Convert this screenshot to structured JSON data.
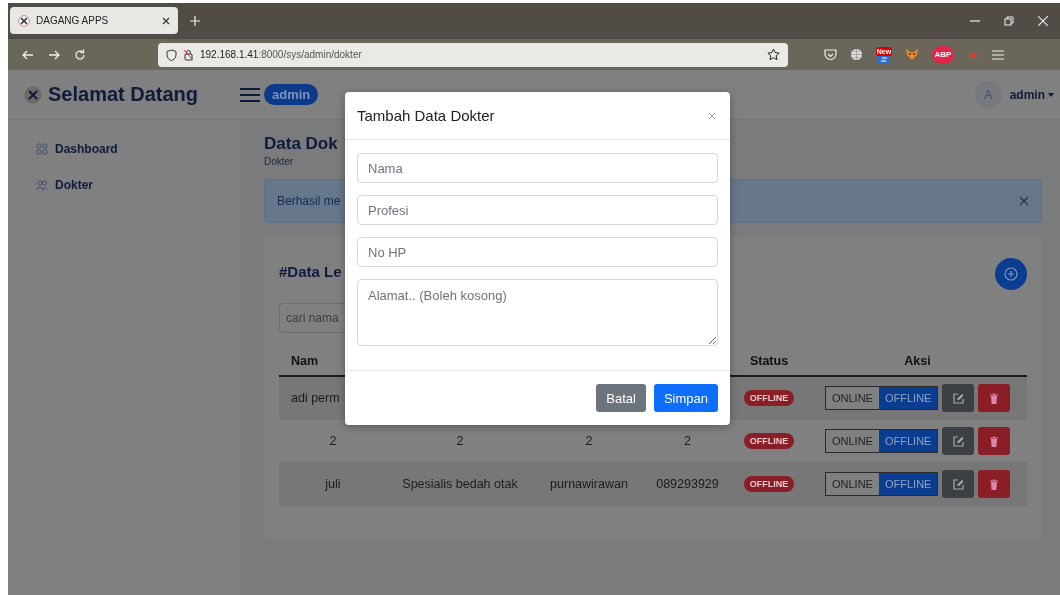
{
  "browser": {
    "tab_title": "DAGANG APPS",
    "url_host": "192.168.1.41",
    "url_rest": ":8000/sys/admin/dokter",
    "extension_badge": "New",
    "adblock_label": "ABP"
  },
  "navbar": {
    "brand": "Selamat Datang",
    "role_badge": "admin",
    "avatar_initial": "A",
    "user": "admin"
  },
  "sidebar": {
    "items": [
      {
        "label": "Dashboard",
        "kind": "grid"
      },
      {
        "label": "Dokter",
        "kind": "users"
      }
    ]
  },
  "page": {
    "title": "Data Dok",
    "breadcrumb": "Dokter"
  },
  "alert": {
    "text": "Berhasil me"
  },
  "card": {
    "title": "#Data Le",
    "search": {
      "placeholder": "cari nama"
    },
    "table": {
      "columns": {
        "column_1": "Nam",
        "status": "Status",
        "aksi": "Aksi"
      },
      "rows": [
        {
          "column_1": "adi perm",
          "status": "OFFLINE",
          "toggle": [
            {
              "label": "ONLINE",
              "selected": false
            },
            {
              "label": "OFFLINE",
              "selected": true
            }
          ]
        },
        {
          "column_1": "2",
          "column_2": "2",
          "column_3": "2",
          "column_4": "2",
          "status": "OFFLINE",
          "toggle": [
            {
              "label": "ONLINE",
              "selected": false
            },
            {
              "label": "OFFLINE",
              "selected": true
            }
          ]
        },
        {
          "column_1": "juli",
          "column_2": "Spesialis bedah otak",
          "column_3": "purnawirawan",
          "column_4": "089293929",
          "status": "OFFLINE",
          "toggle": [
            {
              "label": "ONLINE",
              "selected": false
            },
            {
              "label": "OFFLINE",
              "selected": true
            }
          ]
        }
      ]
    }
  },
  "modal": {
    "title": "Tambah Data Dokter",
    "fields": [
      {
        "placeholder": "Nama",
        "kind": "input"
      },
      {
        "placeholder": "Profesi",
        "kind": "input"
      },
      {
        "placeholder": "No HP",
        "kind": "input"
      },
      {
        "placeholder": "Alamat.. (Boleh kosong)",
        "kind": "textarea"
      }
    ],
    "buttons": [
      {
        "label": "Batal",
        "kind": "secondary"
      },
      {
        "label": "Simpan",
        "kind": "primary"
      }
    ]
  }
}
